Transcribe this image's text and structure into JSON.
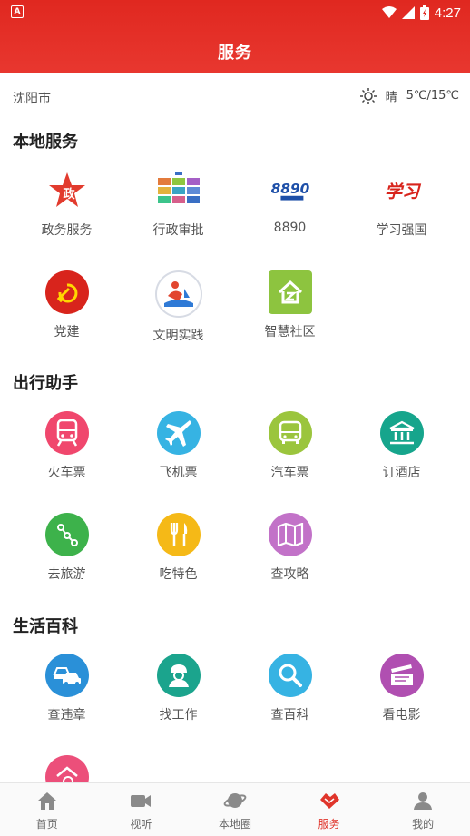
{
  "status": {
    "time": "4:27"
  },
  "header": {
    "title": "服务"
  },
  "location": {
    "city": "沈阳市",
    "weather": "晴",
    "temp": "5℃/15℃"
  },
  "sections": [
    {
      "title": "本地服务",
      "items": [
        {
          "label": "政务服务"
        },
        {
          "label": "行政审批"
        },
        {
          "label": "8890"
        },
        {
          "label": "学习强国"
        },
        {
          "label": "党建"
        },
        {
          "label": "文明实践"
        },
        {
          "label": "智慧社区"
        }
      ]
    },
    {
      "title": "出行助手",
      "items": [
        {
          "label": "火车票"
        },
        {
          "label": "飞机票"
        },
        {
          "label": "汽车票"
        },
        {
          "label": "订酒店"
        },
        {
          "label": "去旅游"
        },
        {
          "label": "吃特色"
        },
        {
          "label": "查攻略"
        }
      ]
    },
    {
      "title": "生活百科",
      "items": [
        {
          "label": "查违章"
        },
        {
          "label": "找工作"
        },
        {
          "label": "查百科"
        },
        {
          "label": "看电影"
        }
      ]
    }
  ],
  "icon_logo_text": {
    "gov": "政",
    "xuexi": "学习",
    "hotline": "8890"
  },
  "colors": {
    "train": "#f0476d",
    "plane": "#36b3e3",
    "bus": "#9bc53d",
    "hotel": "#16a58c",
    "travel": "#3db24b",
    "food": "#f5b917",
    "guide": "#c272c8",
    "violation": "#2a90d8",
    "job": "#1ba48d",
    "wiki": "#36b3e3",
    "movie": "#b04fb1",
    "house": "#ec4f7a",
    "accent": "#e0352b"
  },
  "tabs": [
    {
      "label": "首页"
    },
    {
      "label": "视听"
    },
    {
      "label": "本地圈"
    },
    {
      "label": "服务"
    },
    {
      "label": "我的"
    }
  ]
}
